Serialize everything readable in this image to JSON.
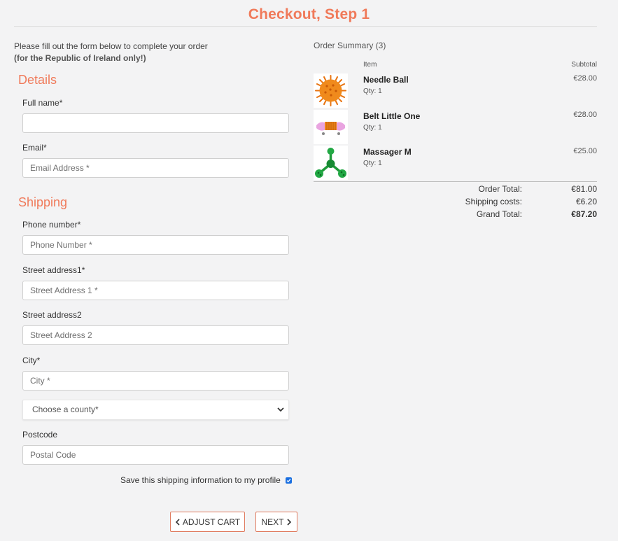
{
  "page": {
    "title": "Checkout, Step 1"
  },
  "intro": {
    "line1": "Please fill out the form below to complete your order",
    "line2": "(for the Republic of Ireland only!)"
  },
  "details": {
    "heading": "Details",
    "full_name": {
      "label": "Full name*",
      "value": "",
      "placeholder": ""
    },
    "email": {
      "label": "Email*",
      "value": "",
      "placeholder": "Email Address *"
    }
  },
  "shipping": {
    "heading": "Shipping",
    "phone": {
      "label": "Phone number*",
      "placeholder": "Phone Number *"
    },
    "street1": {
      "label": "Street address1*",
      "placeholder": "Street Address 1 *"
    },
    "street2": {
      "label": "Street address2",
      "placeholder": "Street Address 2"
    },
    "city": {
      "label": "City*",
      "placeholder": "City *"
    },
    "county": {
      "selected": "Choose a county*"
    },
    "postcode": {
      "label": "Postcode",
      "placeholder": "Postal Code"
    },
    "save_label": "Save this shipping information to my profile",
    "save_checked": true
  },
  "buttons": {
    "adjust_cart": "ADJUST CART",
    "next": "NEXT"
  },
  "summary": {
    "title": "Order Summary (3)",
    "col_item": "Item",
    "col_subtotal": "Subtotal",
    "items": [
      {
        "name": "Needle Ball",
        "qty": "Qty: 1",
        "price": "€28.00",
        "icon": "orange-spiky-ball"
      },
      {
        "name": "Belt Little One",
        "qty": "Qty: 1",
        "price": "€28.00",
        "icon": "pink-belt"
      },
      {
        "name": "Massager M",
        "qty": "Qty: 1",
        "price": "€25.00",
        "icon": "green-massager"
      }
    ],
    "order_total_label": "Order Total:",
    "order_total": "€81.00",
    "shipping_label": "Shipping costs:",
    "shipping_cost": "€6.20",
    "grand_total_label": "Grand Total:",
    "grand_total": "€87.20"
  },
  "colors": {
    "accent": "#f07a5a",
    "checkbox": "#1a6fe0"
  }
}
